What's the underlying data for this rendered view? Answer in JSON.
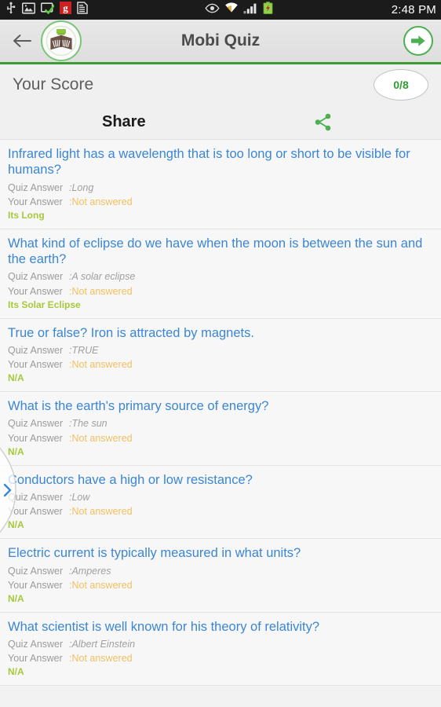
{
  "statusbar": {
    "time": "2:48 PM",
    "left_icons": [
      "usb-icon",
      "gallery-image-icon",
      "screen-check-icon",
      "g-app-badge-icon",
      "sim-card-icon"
    ],
    "right_icons": [
      "eye-smart-stay-icon",
      "wifi-icon",
      "cellular-signal-icon",
      "battery-icon"
    ]
  },
  "actionbar": {
    "back_icon": "back-arrow-icon",
    "logo_icon": "open-book-logo-icon",
    "title": "Mobi Quiz",
    "forward_icon": "forward-arrow-icon"
  },
  "score": {
    "label": "Your Score",
    "value": "0/8"
  },
  "share": {
    "title": "Share",
    "icon": "share-icon"
  },
  "drawer": {
    "handle_icon": "chevron-right-icon"
  },
  "labels": {
    "quiz_answer": "Quiz Answer",
    "your_answer": "Your Answer"
  },
  "colors": {
    "accent_green": "#3f9c35",
    "question_blue": "#3b86d4",
    "unanswered_amber": "#f0c060",
    "result_olive": "#a8c83c",
    "score_green": "#2e9d32"
  },
  "questions": [
    {
      "text": "Infrared light has a wavelength that is too long or short to be visible for humans?",
      "quiz_answer": ":Long",
      "your_answer": ":Not answered",
      "result": "Its Long"
    },
    {
      "text": "What kind of eclipse do we have when the moon is between the sun and the earth?",
      "quiz_answer": ":A solar eclipse",
      "your_answer": ":Not answered",
      "result": "Its Solar Eclipse"
    },
    {
      "text": "True or false? Iron is attracted by magnets.",
      "quiz_answer": ":TRUE",
      "your_answer": ":Not answered",
      "result": "N/A"
    },
    {
      "text": "What is the earth's primary source of energy?",
      "quiz_answer": ":The sun",
      "your_answer": ":Not answered",
      "result": "N/A"
    },
    {
      "text": "Conductors have a high or low resistance?",
      "quiz_answer": ":Low",
      "your_answer": ":Not answered",
      "result": "N/A"
    },
    {
      "text": "Electric current is typically measured in what units?",
      "quiz_answer": ":Amperes",
      "your_answer": ":Not answered",
      "result": "N/A"
    },
    {
      "text": "What scientist is well known for his theory of relativity?",
      "quiz_answer": ":Albert Einstein",
      "your_answer": ":Not answered",
      "result": "N/A"
    }
  ]
}
